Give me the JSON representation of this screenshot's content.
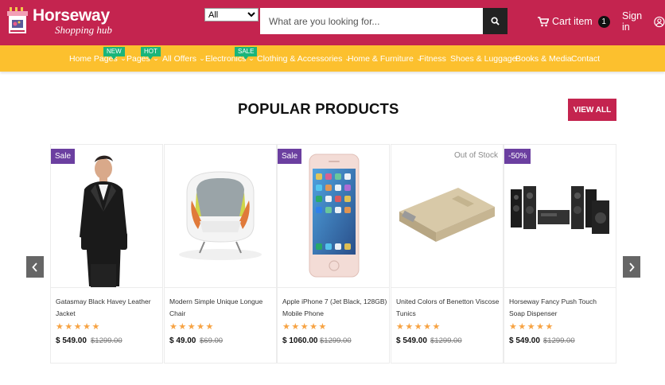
{
  "header": {
    "logo_title": "Horseway",
    "logo_subtitle": "Shopping hub",
    "category_select": "All",
    "search_placeholder": "What are you looking for...",
    "cart_label": "Cart item",
    "cart_count": "1",
    "signin_label": "Sign in"
  },
  "nav": {
    "items": [
      {
        "label": "Home Pages",
        "tag": "NEW"
      },
      {
        "label": "Pages",
        "tag": "HOT"
      },
      {
        "label": "All Offers",
        "tag": ""
      },
      {
        "label": "Electronics",
        "tag": "SALE"
      },
      {
        "label": "Clothing & Accessories",
        "tag": ""
      },
      {
        "label": "Home & Furniture",
        "tag": ""
      },
      {
        "label": "Fitness",
        "tag": ""
      },
      {
        "label": "Shoes & Luggage",
        "tag": ""
      },
      {
        "label": "Books & Media",
        "tag": ""
      },
      {
        "label": "Contact",
        "tag": ""
      }
    ]
  },
  "section": {
    "title": "POPULAR PRODUCTS",
    "view_all": "VIEW ALL"
  },
  "products": [
    {
      "name": "Gatasmay Black Havey Leather Jacket",
      "price": "$ 549.00",
      "old_price": "$1299.00",
      "badge": "Sale",
      "rating": 5
    },
    {
      "name": "Modern Simple Unique Longue Chair",
      "price": "$ 49.00",
      "old_price": "$69.00",
      "badge": "",
      "rating": 5
    },
    {
      "name": "Apple iPhone 7 (Jet Black, 128GB) Mobile Phone",
      "price": "$ 1060.00",
      "old_price": "$1299.00",
      "badge": "Sale",
      "rating": 5
    },
    {
      "name": "United Colors of Benetton Viscose Tunics",
      "price": "$ 549.00",
      "old_price": "$1299.00",
      "badge": "Out of Stock",
      "rating": 5
    },
    {
      "name": "Horseway Fancy Push Touch Soap Dispenser",
      "price": "$ 549.00",
      "old_price": "$1299.00",
      "badge": "-50%",
      "rating": 5
    }
  ],
  "stars": "★★★★★",
  "colors": {
    "brand": "#c4244f",
    "nav": "#fcc02e",
    "tag": "#19b57a",
    "badge": "#6b3fa0",
    "star": "#f7a343"
  },
  "icons": {
    "search": "search-icon",
    "cart": "cart-icon",
    "user": "user-icon",
    "prev": "chevron-left-icon",
    "next": "chevron-right-icon"
  }
}
